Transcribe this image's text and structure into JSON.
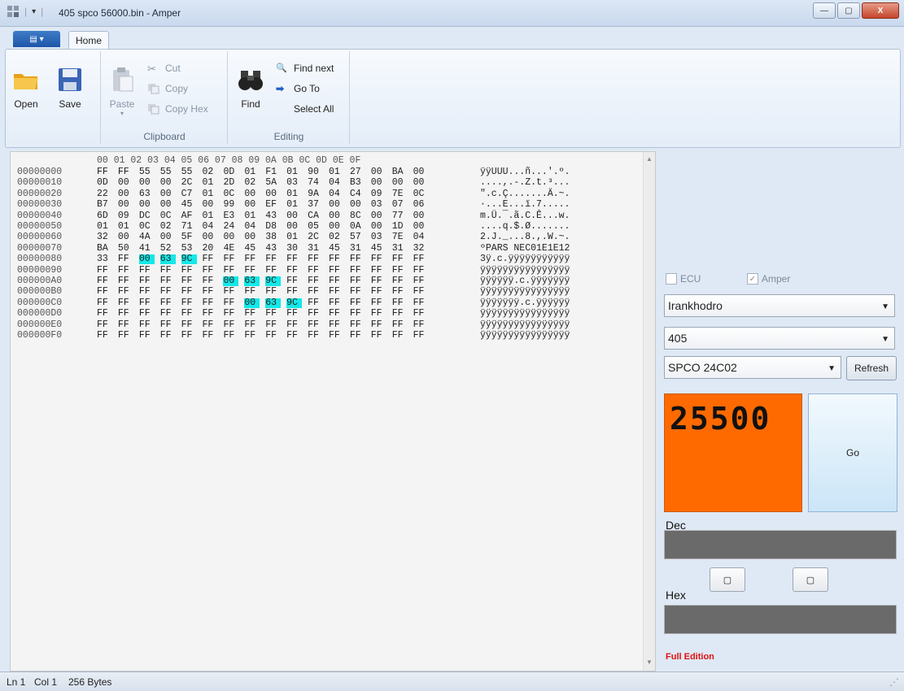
{
  "window": {
    "title": "405 spco 56000.bin - Amper",
    "buttons": {
      "minimize": "—",
      "maximize": "▢",
      "close": "X"
    }
  },
  "ribbon": {
    "app_menu_label": "▤ ▾",
    "tab_home": "Home",
    "groups": {
      "file": {
        "open": "Open",
        "save": "Save"
      },
      "clipboard": {
        "label": "Clipboard",
        "paste": "Paste",
        "cut": "Cut",
        "copy": "Copy",
        "copy_hex": "Copy Hex"
      },
      "editing": {
        "label": "Editing",
        "find": "Find",
        "find_next": "Find next",
        "go_to": "Go To",
        "select_all": "Select All"
      }
    }
  },
  "hex_view": {
    "header": "00 01 02 03 04 05 06 07 08 09 0A 0B 0C 0D 0E 0F",
    "rows": [
      {
        "offset": "00000000",
        "bytes": [
          "FF",
          "FF",
          "55",
          "55",
          "55",
          "02",
          "0D",
          "01",
          "F1",
          "01",
          "90",
          "01",
          "27",
          "00",
          "BA",
          "00"
        ],
        "ascii": "ÿÿUUU...ñ...'.º."
      },
      {
        "offset": "00000010",
        "bytes": [
          "0D",
          "00",
          "00",
          "00",
          "2C",
          "01",
          "2D",
          "02",
          "5A",
          "03",
          "74",
          "04",
          "B3",
          "00",
          "00",
          "00"
        ],
        "ascii": "....,.-.Z.t.³..."
      },
      {
        "offset": "00000020",
        "bytes": [
          "22",
          "00",
          "63",
          "00",
          "C7",
          "01",
          "0C",
          "00",
          "00",
          "01",
          "9A",
          "04",
          "C4",
          "09",
          "7E",
          "0C"
        ],
        "ascii": "\".c.Ç.......Ä.~."
      },
      {
        "offset": "00000030",
        "bytes": [
          "B7",
          "00",
          "00",
          "00",
          "45",
          "00",
          "99",
          "00",
          "EF",
          "01",
          "37",
          "00",
          "00",
          "03",
          "07",
          "06"
        ],
        "ascii": "·...E...ï.7....."
      },
      {
        "offset": "00000040",
        "bytes": [
          "6D",
          "09",
          "DC",
          "0C",
          "AF",
          "01",
          "E3",
          "01",
          "43",
          "00",
          "CA",
          "00",
          "8C",
          "00",
          "77",
          "00"
        ],
        "ascii": "m.Ü.¯.ã.C.Ê...w."
      },
      {
        "offset": "00000050",
        "bytes": [
          "01",
          "01",
          "0C",
          "02",
          "71",
          "04",
          "24",
          "04",
          "D8",
          "00",
          "05",
          "00",
          "0A",
          "00",
          "1D",
          "00"
        ],
        "ascii": "....q.$.Ø......."
      },
      {
        "offset": "00000060",
        "bytes": [
          "32",
          "00",
          "4A",
          "00",
          "5F",
          "00",
          "00",
          "00",
          "38",
          "01",
          "2C",
          "02",
          "57",
          "03",
          "7E",
          "04"
        ],
        "ascii": "2.J._...8.,.W.~."
      },
      {
        "offset": "00000070",
        "bytes": [
          "BA",
          "50",
          "41",
          "52",
          "53",
          "20",
          "4E",
          "45",
          "43",
          "30",
          "31",
          "45",
          "31",
          "45",
          "31",
          "32"
        ],
        "ascii": "ºPARS NEC01E1E12"
      },
      {
        "offset": "00000080",
        "bytes": [
          "33",
          "FF",
          "00",
          "63",
          "9C",
          "FF",
          "FF",
          "FF",
          "FF",
          "FF",
          "FF",
          "FF",
          "FF",
          "FF",
          "FF",
          "FF"
        ],
        "ascii": "3ÿ.c.ÿÿÿÿÿÿÿÿÿÿÿ",
        "hl": [
          2,
          3,
          4
        ]
      },
      {
        "offset": "00000090",
        "bytes": [
          "FF",
          "FF",
          "FF",
          "FF",
          "FF",
          "FF",
          "FF",
          "FF",
          "FF",
          "FF",
          "FF",
          "FF",
          "FF",
          "FF",
          "FF",
          "FF"
        ],
        "ascii": "ÿÿÿÿÿÿÿÿÿÿÿÿÿÿÿÿ"
      },
      {
        "offset": "000000A0",
        "bytes": [
          "FF",
          "FF",
          "FF",
          "FF",
          "FF",
          "FF",
          "00",
          "63",
          "9C",
          "FF",
          "FF",
          "FF",
          "FF",
          "FF",
          "FF",
          "FF"
        ],
        "ascii": "ÿÿÿÿÿÿ.c.ÿÿÿÿÿÿÿ",
        "hl": [
          6,
          7,
          8
        ]
      },
      {
        "offset": "000000B0",
        "bytes": [
          "FF",
          "FF",
          "FF",
          "FF",
          "FF",
          "FF",
          "FF",
          "FF",
          "FF",
          "FF",
          "FF",
          "FF",
          "FF",
          "FF",
          "FF",
          "FF"
        ],
        "ascii": "ÿÿÿÿÿÿÿÿÿÿÿÿÿÿÿÿ"
      },
      {
        "offset": "000000C0",
        "bytes": [
          "FF",
          "FF",
          "FF",
          "FF",
          "FF",
          "FF",
          "FF",
          "00",
          "63",
          "9C",
          "FF",
          "FF",
          "FF",
          "FF",
          "FF",
          "FF"
        ],
        "ascii": "ÿÿÿÿÿÿÿ.c.ÿÿÿÿÿÿ",
        "hl": [
          7,
          8,
          9
        ]
      },
      {
        "offset": "000000D0",
        "bytes": [
          "FF",
          "FF",
          "FF",
          "FF",
          "FF",
          "FF",
          "FF",
          "FF",
          "FF",
          "FF",
          "FF",
          "FF",
          "FF",
          "FF",
          "FF",
          "FF"
        ],
        "ascii": "ÿÿÿÿÿÿÿÿÿÿÿÿÿÿÿÿ"
      },
      {
        "offset": "000000E0",
        "bytes": [
          "FF",
          "FF",
          "FF",
          "FF",
          "FF",
          "FF",
          "FF",
          "FF",
          "FF",
          "FF",
          "FF",
          "FF",
          "FF",
          "FF",
          "FF",
          "FF"
        ],
        "ascii": "ÿÿÿÿÿÿÿÿÿÿÿÿÿÿÿÿ"
      },
      {
        "offset": "000000F0",
        "bytes": [
          "FF",
          "FF",
          "FF",
          "FF",
          "FF",
          "FF",
          "FF",
          "FF",
          "FF",
          "FF",
          "FF",
          "FF",
          "FF",
          "FF",
          "FF",
          "FF"
        ],
        "ascii": "ÿÿÿÿÿÿÿÿÿÿÿÿÿÿÿÿ"
      }
    ],
    "highlight_color": "#14e8e8"
  },
  "panel": {
    "chk_ecu": "ECU",
    "chk_amper": "Amper",
    "make_select": "Irankhodro",
    "model_select": "405",
    "chip_select": "SPCO 24C02",
    "refresh": "Refresh",
    "display_value": "25500",
    "go": "Go",
    "dec_label": "Dec",
    "hex_label": "Hex",
    "edition": "Full Edition",
    "lcd_color": "#ff6a00"
  },
  "status": {
    "line": "Ln 1",
    "col": "Col 1",
    "size": "256 Bytes"
  }
}
